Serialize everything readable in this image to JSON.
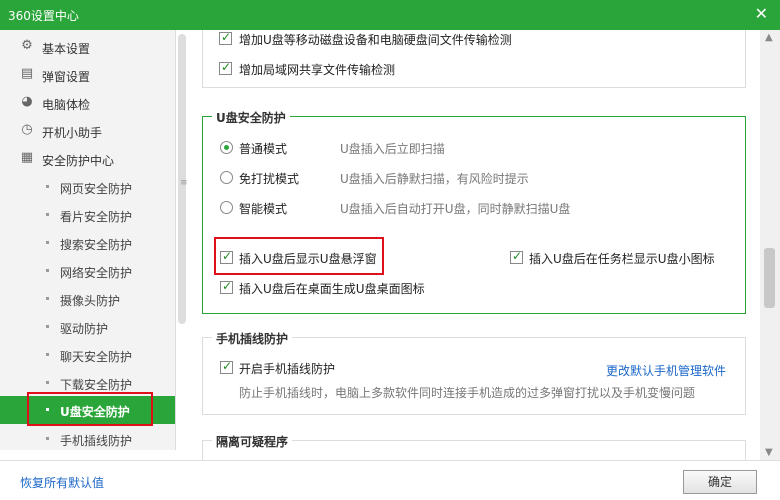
{
  "window": {
    "title": "360设置中心",
    "close_glyph": "✕"
  },
  "sidebar": {
    "items": [
      {
        "label": "基本设置",
        "icon": "gear-icon"
      },
      {
        "label": "弹窗设置",
        "icon": "window-icon"
      },
      {
        "label": "电脑体检",
        "icon": "checkup-icon"
      },
      {
        "label": "开机小助手",
        "icon": "clock-icon"
      },
      {
        "label": "安全防护中心",
        "icon": "shield-grid-icon"
      }
    ],
    "subitems": [
      {
        "label": "网页安全防护"
      },
      {
        "label": "看片安全防护"
      },
      {
        "label": "搜索安全防护"
      },
      {
        "label": "网络安全防护"
      },
      {
        "label": "摄像头防护"
      },
      {
        "label": "驱动防护"
      },
      {
        "label": "聊天安全防护"
      },
      {
        "label": "下载安全防护"
      },
      {
        "label": "U盘安全防护",
        "active": true
      },
      {
        "label": "手机插线防护"
      }
    ]
  },
  "top_options": [
    {
      "label": "增加U盘等移动磁盘设备和电脑硬盘间文件传输检测",
      "checked": true
    },
    {
      "label": "增加局域网共享文件传输检测",
      "checked": true
    }
  ],
  "usb_section": {
    "title": "U盘安全防护",
    "modes": [
      {
        "label": "普通模式",
        "desc": "U盘插入后立即扫描",
        "selected": true
      },
      {
        "label": "免打扰模式",
        "desc": "U盘插入后静默扫描，有风险时提示",
        "selected": false
      },
      {
        "label": "智能模式",
        "desc": "U盘插入后自动打开U盘，同时静默扫描U盘",
        "selected": false
      }
    ],
    "options": {
      "float_window": "插入U盘后显示U盘悬浮窗",
      "taskbar_icon": "插入U盘后在任务栏显示U盘小图标",
      "desktop_icon": "插入U盘后在桌面生成U盘桌面图标"
    }
  },
  "phone_section": {
    "title": "手机插线防护",
    "enable_label": "开启手机插线防护",
    "link": "更改默认手机管理软件",
    "desc": "防止手机插线时，电脑上多款软件同时连接手机造成的过多弹窗打扰以及手机变慢问题"
  },
  "quarantine_section": {
    "title": "隔离可疑程序"
  },
  "footer": {
    "restore_label": "恢复所有默认值",
    "ok_label": "确定"
  },
  "colors": {
    "accent": "#2aa539",
    "highlight": "#e0101a",
    "link": "#1b66c9"
  }
}
